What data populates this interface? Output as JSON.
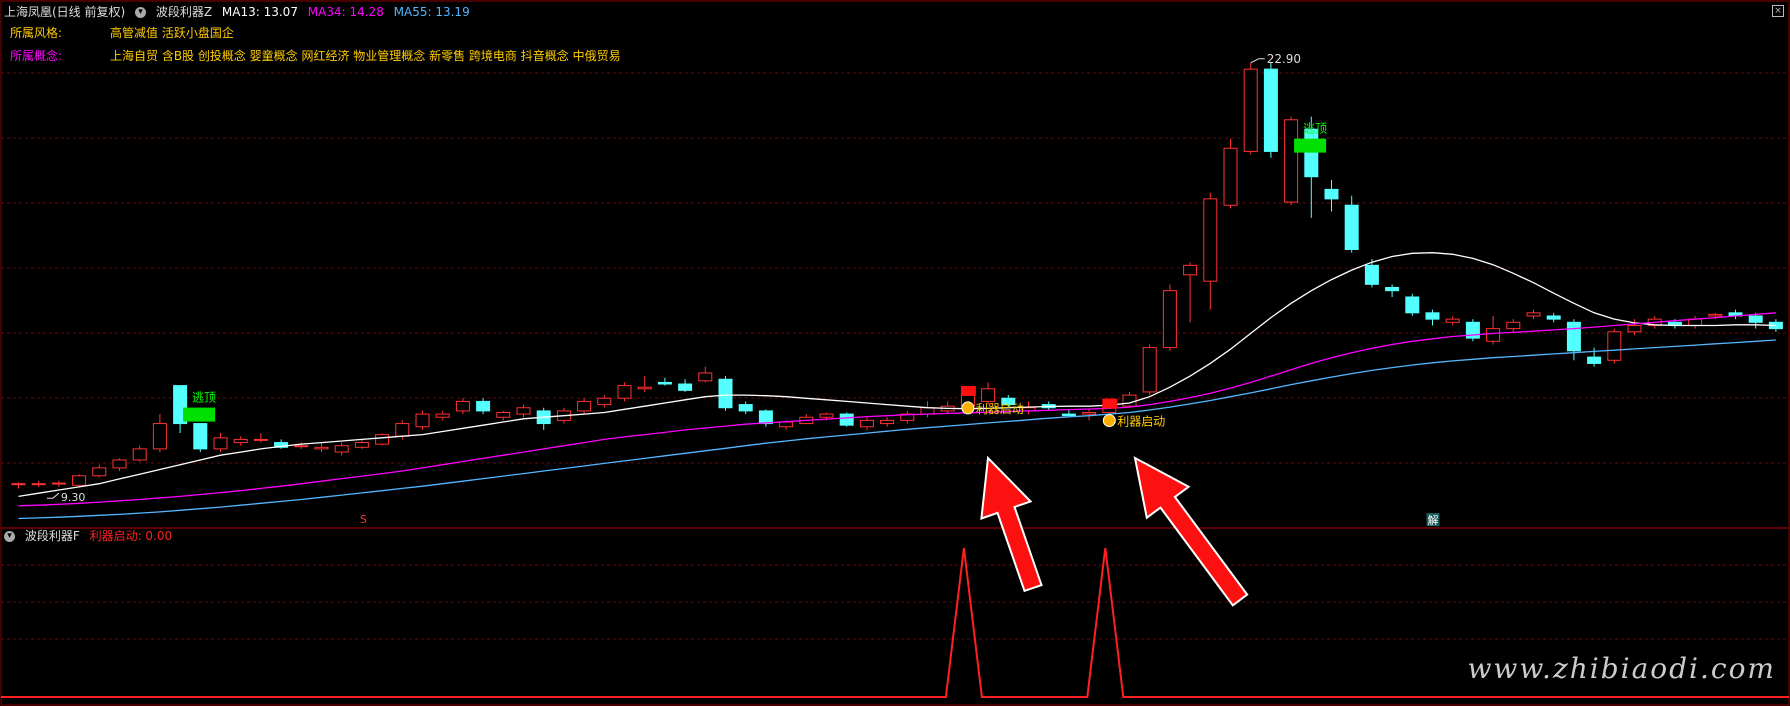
{
  "header": {
    "stock": "上海凤凰(日线 前复权)",
    "indicator": "波段利器Z",
    "ma13": "MA13: 13.07",
    "ma34": "MA34: 14.28",
    "ma55": "MA55: 13.19"
  },
  "info": {
    "style_label": "所属风格:",
    "style_value": "高管减值 活跃小盘国企",
    "concept_label": "所属概念:",
    "concept_value": "上海自贸 含B股 创投概念 婴童概念 网红经济 物业管理概念 新零售 跨境电商 抖音概念 中俄贸易"
  },
  "sub_header": {
    "indicator": "波段利器F",
    "signal": "利器启动: 0.00"
  },
  "watermark": "www.zhibiaodi.com",
  "colors": {
    "up": "#ff3232",
    "down": "#54ffff",
    "ma13": "#ffffff",
    "ma34": "#ff00ff",
    "ma55": "#54b6ff",
    "grid": "#7a0000",
    "signal_line": "#ff2020"
  },
  "chart_data": {
    "type": "candlestick",
    "price_range": [
      8.2,
      24.0
    ],
    "max_label": "22.90",
    "min_label": "9.30",
    "candles": [
      [
        9.6,
        9.65,
        9.45,
        9.6
      ],
      [
        9.6,
        9.7,
        9.5,
        9.6
      ],
      [
        9.6,
        9.7,
        9.5,
        9.62
      ],
      [
        9.55,
        9.9,
        9.5,
        9.85
      ],
      [
        9.85,
        10.2,
        9.8,
        10.1
      ],
      [
        10.1,
        10.4,
        10.0,
        10.35
      ],
      [
        10.35,
        10.8,
        10.3,
        10.7
      ],
      [
        10.7,
        11.8,
        10.6,
        11.5
      ],
      [
        12.7,
        12.7,
        11.2,
        11.5
      ],
      [
        11.5,
        11.5,
        10.6,
        10.7
      ],
      [
        10.7,
        11.2,
        10.6,
        11.05
      ],
      [
        10.9,
        11.1,
        10.8,
        11.0
      ],
      [
        11.0,
        11.2,
        10.9,
        11.0
      ],
      [
        10.9,
        11.0,
        10.7,
        10.75
      ],
      [
        10.8,
        10.9,
        10.7,
        10.8
      ],
      [
        10.7,
        10.9,
        10.6,
        10.75
      ],
      [
        10.6,
        10.9,
        10.5,
        10.8
      ],
      [
        10.75,
        11.0,
        10.7,
        10.9
      ],
      [
        10.85,
        11.2,
        10.8,
        11.15
      ],
      [
        11.1,
        11.6,
        11.0,
        11.5
      ],
      [
        11.4,
        11.9,
        11.3,
        11.8
      ],
      [
        11.7,
        11.9,
        11.6,
        11.8
      ],
      [
        11.9,
        12.3,
        11.8,
        12.2
      ],
      [
        12.2,
        12.3,
        11.8,
        11.9
      ],
      [
        11.7,
        11.9,
        11.6,
        11.85
      ],
      [
        11.8,
        12.1,
        11.7,
        12.0
      ],
      [
        11.9,
        12.0,
        11.3,
        11.5
      ],
      [
        11.6,
        12.0,
        11.5,
        11.9
      ],
      [
        11.9,
        12.3,
        11.8,
        12.2
      ],
      [
        12.1,
        12.4,
        12.0,
        12.3
      ],
      [
        12.3,
        12.8,
        12.2,
        12.7
      ],
      [
        12.6,
        13.0,
        12.5,
        12.65
      ],
      [
        12.8,
        12.95,
        12.7,
        12.75
      ],
      [
        12.75,
        12.9,
        12.5,
        12.55
      ],
      [
        12.85,
        13.3,
        12.8,
        13.1
      ],
      [
        12.9,
        13.0,
        11.9,
        12.0
      ],
      [
        12.1,
        12.2,
        11.8,
        11.9
      ],
      [
        11.9,
        11.95,
        11.4,
        11.5
      ],
      [
        11.4,
        11.6,
        11.3,
        11.55
      ],
      [
        11.5,
        11.8,
        11.5,
        11.7
      ],
      [
        11.7,
        11.85,
        11.6,
        11.8
      ],
      [
        11.8,
        11.85,
        11.4,
        11.45
      ],
      [
        11.4,
        11.7,
        11.3,
        11.6
      ],
      [
        11.5,
        11.7,
        11.4,
        11.6
      ],
      [
        11.6,
        11.9,
        11.5,
        11.8
      ],
      [
        11.8,
        12.2,
        11.7,
        12.0
      ],
      [
        11.9,
        12.2,
        11.8,
        12.05
      ],
      [
        12.05,
        12.5,
        12.0,
        12.4
      ],
      [
        12.2,
        12.8,
        12.1,
        12.6
      ],
      [
        12.3,
        12.4,
        12.0,
        12.1
      ],
      [
        11.9,
        12.2,
        11.8,
        12.0
      ],
      [
        12.1,
        12.2,
        11.9,
        12.0
      ],
      [
        11.8,
        11.95,
        11.7,
        11.75
      ],
      [
        11.8,
        11.95,
        11.6,
        11.85
      ],
      [
        11.85,
        12.1,
        11.8,
        12.05
      ],
      [
        12.05,
        12.5,
        12.0,
        12.4
      ],
      [
        12.5,
        14.0,
        12.4,
        13.9
      ],
      [
        13.9,
        15.9,
        13.8,
        15.7
      ],
      [
        16.2,
        16.6,
        14.7,
        16.5
      ],
      [
        16.0,
        18.8,
        15.1,
        18.6
      ],
      [
        18.4,
        20.5,
        18.3,
        20.2
      ],
      [
        20.1,
        22.9,
        20.0,
        22.7
      ],
      [
        22.7,
        22.9,
        19.9,
        20.1
      ],
      [
        18.5,
        21.2,
        18.4,
        21.1
      ],
      [
        20.8,
        21.2,
        18.0,
        19.3
      ],
      [
        18.9,
        19.2,
        18.2,
        18.6
      ],
      [
        18.4,
        18.7,
        16.9,
        17.0
      ],
      [
        16.5,
        16.7,
        15.8,
        15.9
      ],
      [
        15.8,
        15.9,
        15.5,
        15.7
      ],
      [
        15.5,
        15.6,
        14.9,
        15.0
      ],
      [
        15.0,
        15.1,
        14.6,
        14.8
      ],
      [
        14.7,
        14.9,
        14.6,
        14.8
      ],
      [
        14.7,
        14.8,
        14.1,
        14.2
      ],
      [
        14.1,
        14.9,
        14.0,
        14.5
      ],
      [
        14.5,
        14.8,
        14.4,
        14.7
      ],
      [
        14.9,
        15.1,
        14.8,
        15.0
      ],
      [
        14.9,
        15.0,
        14.7,
        14.8
      ],
      [
        14.7,
        14.8,
        13.5,
        13.8
      ],
      [
        13.6,
        13.9,
        13.3,
        13.4
      ],
      [
        13.5,
        14.5,
        13.4,
        14.4
      ],
      [
        14.4,
        14.8,
        14.3,
        14.6
      ],
      [
        14.6,
        14.9,
        14.5,
        14.8
      ],
      [
        14.7,
        14.8,
        14.5,
        14.6
      ],
      [
        14.6,
        14.9,
        14.5,
        14.8
      ],
      [
        14.9,
        15.0,
        14.8,
        14.95
      ],
      [
        15.0,
        15.1,
        14.8,
        14.9
      ],
      [
        14.9,
        15.0,
        14.5,
        14.7
      ],
      [
        14.7,
        14.8,
        14.4,
        14.5
      ]
    ],
    "ma13": [
      9.2,
      9.3,
      9.4,
      9.5,
      9.6,
      9.75,
      9.9,
      10.05,
      10.2,
      10.35,
      10.5,
      10.6,
      10.7,
      10.78,
      10.85,
      10.9,
      10.95,
      11.0,
      11.05,
      11.1,
      11.15,
      11.25,
      11.35,
      11.45,
      11.55,
      11.65,
      11.7,
      11.75,
      11.8,
      11.85,
      11.95,
      12.05,
      12.15,
      12.25,
      12.35,
      12.4,
      12.4,
      12.38,
      12.35,
      12.3,
      12.25,
      12.2,
      12.15,
      12.1,
      12.05,
      12.0,
      11.98,
      11.97,
      11.98,
      12.0,
      12.02,
      12.04,
      12.05,
      12.05,
      12.08,
      12.15,
      12.35,
      12.65,
      13.0,
      13.4,
      13.85,
      14.35,
      14.85,
      15.3,
      15.7,
      16.05,
      16.35,
      16.6,
      16.78,
      16.88,
      16.9,
      16.85,
      16.72,
      16.52,
      16.25,
      15.95,
      15.62,
      15.3,
      15.0,
      14.8,
      14.68,
      14.62,
      14.6,
      14.6,
      14.6,
      14.62,
      14.62,
      14.6
    ],
    "ma34": [
      8.9,
      8.92,
      8.95,
      8.98,
      9.02,
      9.06,
      9.1,
      9.15,
      9.2,
      9.26,
      9.32,
      9.38,
      9.45,
      9.52,
      9.6,
      9.68,
      9.76,
      9.84,
      9.92,
      10.0,
      10.1,
      10.2,
      10.3,
      10.4,
      10.5,
      10.6,
      10.7,
      10.8,
      10.9,
      11.0,
      11.08,
      11.15,
      11.22,
      11.3,
      11.36,
      11.42,
      11.48,
      11.52,
      11.56,
      11.6,
      11.64,
      11.68,
      11.72,
      11.75,
      11.78,
      11.8,
      11.82,
      11.84,
      11.86,
      11.88,
      11.9,
      11.92,
      11.94,
      11.96,
      11.98,
      12.02,
      12.1,
      12.2,
      12.32,
      12.46,
      12.62,
      12.8,
      13.0,
      13.2,
      13.4,
      13.58,
      13.74,
      13.88,
      14.0,
      14.1,
      14.18,
      14.25,
      14.3,
      14.35,
      14.38,
      14.42,
      14.46,
      14.5,
      14.55,
      14.6,
      14.65,
      14.7,
      14.75,
      14.8,
      14.85,
      14.9,
      14.95,
      15.0
    ],
    "ma55": [
      8.5,
      8.52,
      8.54,
      8.57,
      8.6,
      8.63,
      8.67,
      8.71,
      8.76,
      8.81,
      8.86,
      8.92,
      8.98,
      9.04,
      9.1,
      9.17,
      9.24,
      9.31,
      9.38,
      9.45,
      9.52,
      9.6,
      9.68,
      9.76,
      9.84,
      9.92,
      10.0,
      10.08,
      10.16,
      10.24,
      10.32,
      10.4,
      10.48,
      10.56,
      10.64,
      10.72,
      10.8,
      10.88,
      10.95,
      11.02,
      11.08,
      11.14,
      11.2,
      11.26,
      11.32,
      11.37,
      11.42,
      11.47,
      11.52,
      11.57,
      11.62,
      11.67,
      11.71,
      11.75,
      11.8,
      11.85,
      11.93,
      12.02,
      12.12,
      12.23,
      12.35,
      12.47,
      12.6,
      12.73,
      12.85,
      12.97,
      13.08,
      13.18,
      13.27,
      13.35,
      13.42,
      13.48,
      13.53,
      13.58,
      13.62,
      13.66,
      13.7,
      13.74,
      13.78,
      13.82,
      13.86,
      13.9,
      13.94,
      13.98,
      14.02,
      14.06,
      14.1,
      14.14
    ],
    "escape_signals": [
      {
        "index": 8,
        "label": "逃顶"
      },
      {
        "index": 63,
        "label": "逃顶"
      }
    ],
    "start_signals": [
      {
        "index": 47,
        "label": "利器启动"
      },
      {
        "index": 54,
        "label": "利器启动"
      }
    ],
    "marker_s": {
      "index": 17,
      "label": "S"
    },
    "marker_jie": {
      "index": 70,
      "label": "解"
    },
    "sub_signal": {
      "values_index": [
        47,
        54
      ],
      "range": [
        0,
        1
      ]
    }
  }
}
